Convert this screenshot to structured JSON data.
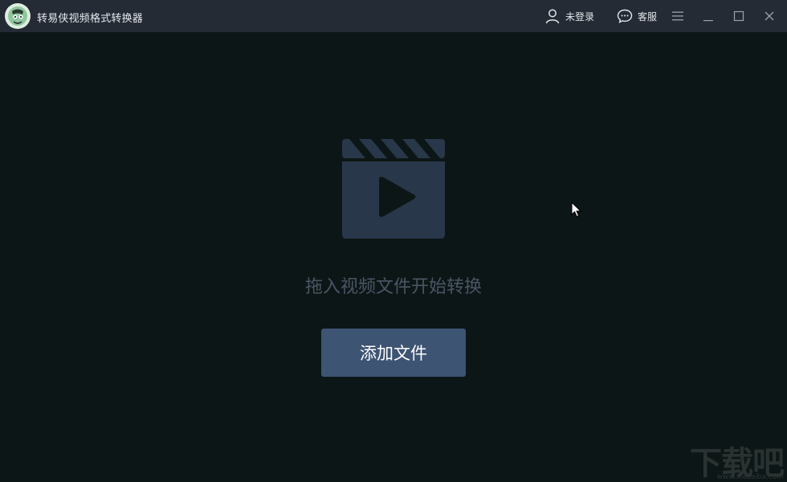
{
  "window": {
    "title": "转易侠视频格式转换器",
    "icons": {
      "logo": "app-logo-icon",
      "user": "user-icon",
      "chat": "chat-bubble-icon",
      "menu": "hamburger-menu-icon",
      "minimize": "minimize-icon",
      "maximize": "maximize-icon",
      "close": "close-icon"
    }
  },
  "header": {
    "login_label": "未登录",
    "service_label": "客服"
  },
  "main": {
    "placeholder_icon": "video-clapperboard-icon",
    "drop_hint": "拖入视频文件开始转换",
    "add_button_label": "添加文件"
  },
  "watermark": {
    "text": "下载吧",
    "url": "www.xiazaiba.com"
  },
  "colors": {
    "background": "#0c1616",
    "titlebar": "#242b35",
    "button": "#3d5473",
    "hint_text": "#4a5564",
    "clapper": "#29374a"
  }
}
